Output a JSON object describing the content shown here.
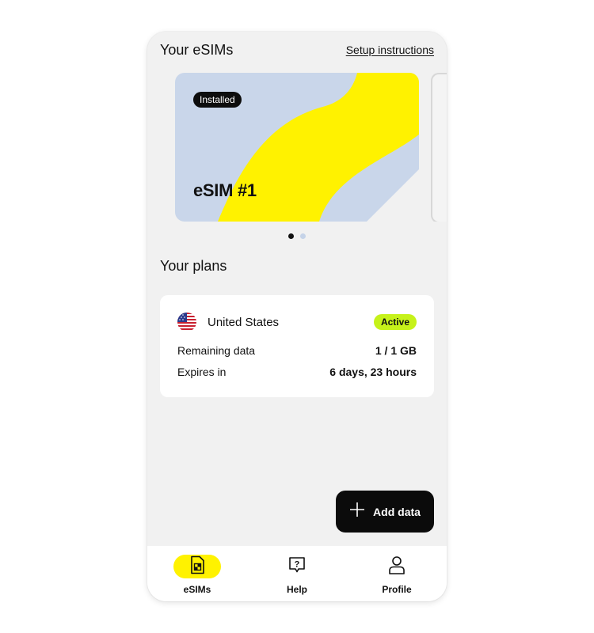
{
  "header": {
    "title": "Your eSIMs",
    "link": "Setup instructions"
  },
  "esim_card": {
    "badge": "Installed",
    "name": "eSIM #1",
    "colors": {
      "base": "#c9d6ea",
      "accent": "#fff200"
    }
  },
  "carousel": {
    "page_count": 2,
    "current_page": 1
  },
  "plans": {
    "title": "Your plans",
    "items": [
      {
        "country": "United States",
        "flag": "us-flag-icon",
        "status": "Active",
        "remaining_label": "Remaining data",
        "remaining_value": "1 / 1 GB",
        "expires_label": "Expires in",
        "expires_value": "6 days, 23 hours"
      }
    ]
  },
  "fab": {
    "label": "Add data",
    "icon": "plus-icon"
  },
  "bottom_nav": {
    "items": [
      {
        "label": "eSIMs",
        "icon": "sim-card-icon",
        "selected": true
      },
      {
        "label": "Help",
        "icon": "help-chat-icon",
        "selected": false
      },
      {
        "label": "Profile",
        "icon": "person-icon",
        "selected": false
      }
    ]
  }
}
